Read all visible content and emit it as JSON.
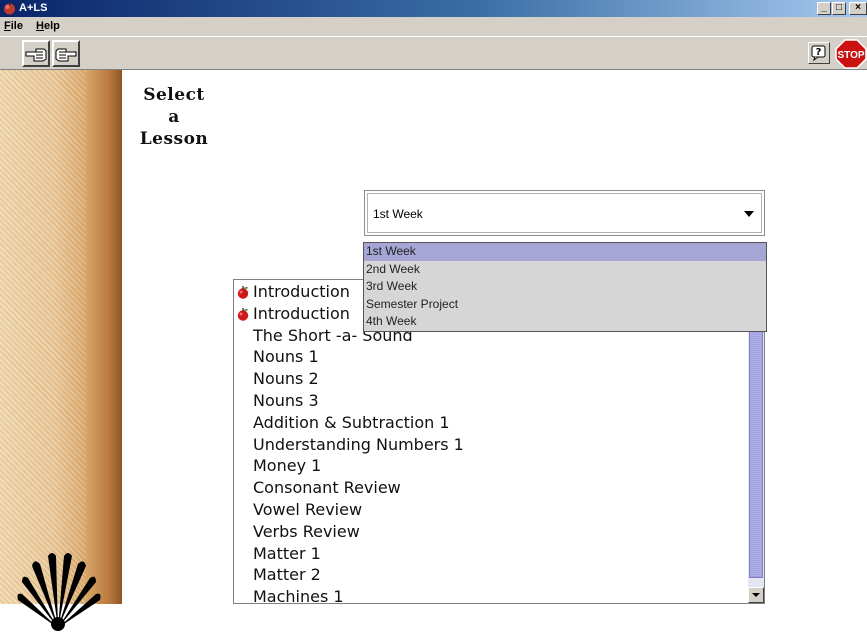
{
  "window": {
    "title": "A+LS",
    "minimize": "_",
    "maximize": "□",
    "close": "×"
  },
  "menu": {
    "items": [
      {
        "accel": "F",
        "rest": "ile"
      },
      {
        "accel": "H",
        "rest": "elp"
      }
    ]
  },
  "toolbar": {
    "back_icon": "hand-pointing-left-icon",
    "forward_icon": "hand-pointing-right-icon",
    "help_icon": "question-balloon-icon",
    "stop_label": "STOP"
  },
  "colors": {
    "titlebar": "#0a246a",
    "chrome": "#d4d0c8",
    "stop_red": "#cc1111",
    "dropdown_selection": "#a6a6d6",
    "scroll_thumb": "#9f9fe0"
  },
  "lesson_picker": {
    "label_line1": "Select",
    "label_line2": "a",
    "label_line3": "Lesson",
    "selected_value": "1st Week",
    "options": [
      "1st Week",
      "2nd Week",
      "3rd Week",
      "Semester Project",
      "4th Week"
    ],
    "highlighted_index": 0
  },
  "lessons": [
    {
      "title": "Introduction",
      "apple": true
    },
    {
      "title": "Introduction",
      "apple": true
    },
    {
      "title": "The Short -a- Sound",
      "apple": false
    },
    {
      "title": "Nouns 1",
      "apple": false
    },
    {
      "title": "Nouns 2",
      "apple": false
    },
    {
      "title": "Nouns 3",
      "apple": false
    },
    {
      "title": "Addition & Subtraction 1",
      "apple": false
    },
    {
      "title": "Understanding Numbers 1",
      "apple": false
    },
    {
      "title": "Money 1",
      "apple": false
    },
    {
      "title": "Consonant Review",
      "apple": false
    },
    {
      "title": "Vowel Review",
      "apple": false
    },
    {
      "title": "Verbs Review",
      "apple": false
    },
    {
      "title": "Matter 1",
      "apple": false
    },
    {
      "title": "Matter 2",
      "apple": false
    },
    {
      "title": "Machines 1",
      "apple": false
    }
  ]
}
